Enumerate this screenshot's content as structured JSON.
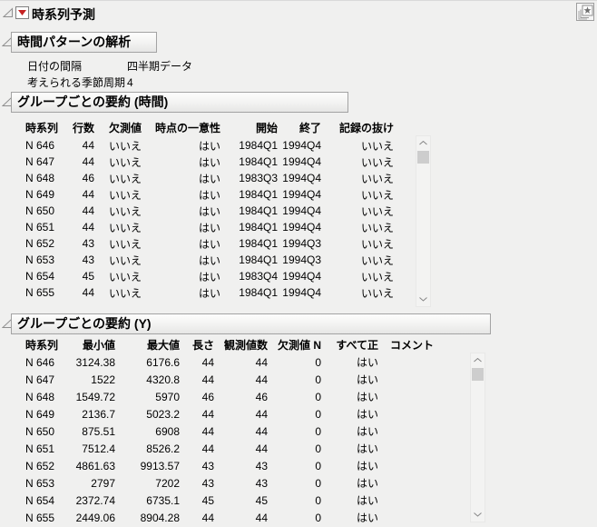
{
  "window": {
    "title": "時系列予測"
  },
  "icons": {
    "disclosure": "open-triangle",
    "red_triangle_menu": "red-down-triangle",
    "star": "★",
    "scroll_up": "chevron-up",
    "scroll_down": "chevron-down"
  },
  "colors": {
    "background": "#f0f0ef",
    "red_triangle": "#c52222",
    "header_box_border": "#a3a3a3",
    "scrollbar_thumb": "#cdcdcd"
  },
  "sections": {
    "time_pattern": {
      "title": "時間パターンの解析",
      "rows": [
        {
          "label": "日付の間隔",
          "value": "四半期データ"
        },
        {
          "label": "考えられる季節周期",
          "value": "4"
        }
      ]
    },
    "group_summary_time": {
      "title": "グループごとの要約 (時間)",
      "columns": [
        "時系列",
        "行数",
        "欠測値",
        "時点の一意性",
        "開始",
        "終了",
        "記録の抜け"
      ],
      "rows": [
        [
          "N 646",
          "44",
          "いいえ",
          "はい",
          "1984Q1",
          "1994Q4",
          "いいえ"
        ],
        [
          "N 647",
          "44",
          "いいえ",
          "はい",
          "1984Q1",
          "1994Q4",
          "いいえ"
        ],
        [
          "N 648",
          "46",
          "いいえ",
          "はい",
          "1983Q3",
          "1994Q4",
          "いいえ"
        ],
        [
          "N 649",
          "44",
          "いいえ",
          "はい",
          "1984Q1",
          "1994Q4",
          "いいえ"
        ],
        [
          "N 650",
          "44",
          "いいえ",
          "はい",
          "1984Q1",
          "1994Q4",
          "いいえ"
        ],
        [
          "N 651",
          "44",
          "いいえ",
          "はい",
          "1984Q1",
          "1994Q4",
          "いいえ"
        ],
        [
          "N 652",
          "43",
          "いいえ",
          "はい",
          "1984Q1",
          "1994Q3",
          "いいえ"
        ],
        [
          "N 653",
          "43",
          "いいえ",
          "はい",
          "1984Q1",
          "1994Q3",
          "いいえ"
        ],
        [
          "N 654",
          "45",
          "いいえ",
          "はい",
          "1983Q4",
          "1994Q4",
          "いいえ"
        ],
        [
          "N 655",
          "44",
          "いいえ",
          "はい",
          "1984Q1",
          "1994Q4",
          "いいえ"
        ]
      ]
    },
    "group_summary_y": {
      "title": "グループごとの要約 (Y)",
      "columns": [
        "時系列",
        "最小値",
        "最大値",
        "長さ",
        "観測値数",
        "欠測値 N",
        "すべて正",
        "コメント"
      ],
      "rows": [
        [
          "N 646",
          "3124.38",
          "6176.6",
          "44",
          "44",
          "0",
          "はい",
          ""
        ],
        [
          "N 647",
          "1522",
          "4320.8",
          "44",
          "44",
          "0",
          "はい",
          ""
        ],
        [
          "N 648",
          "1549.72",
          "5970",
          "46",
          "46",
          "0",
          "はい",
          ""
        ],
        [
          "N 649",
          "2136.7",
          "5023.2",
          "44",
          "44",
          "0",
          "はい",
          ""
        ],
        [
          "N 650",
          "875.51",
          "6908",
          "44",
          "44",
          "0",
          "はい",
          ""
        ],
        [
          "N 651",
          "7512.4",
          "8526.2",
          "44",
          "44",
          "0",
          "はい",
          ""
        ],
        [
          "N 652",
          "4861.63",
          "9913.57",
          "43",
          "43",
          "0",
          "はい",
          ""
        ],
        [
          "N 653",
          "2797",
          "7202",
          "43",
          "43",
          "0",
          "はい",
          ""
        ],
        [
          "N 654",
          "2372.74",
          "6735.1",
          "45",
          "45",
          "0",
          "はい",
          ""
        ],
        [
          "N 655",
          "2449.06",
          "8904.28",
          "44",
          "44",
          "0",
          "はい",
          ""
        ]
      ]
    }
  }
}
